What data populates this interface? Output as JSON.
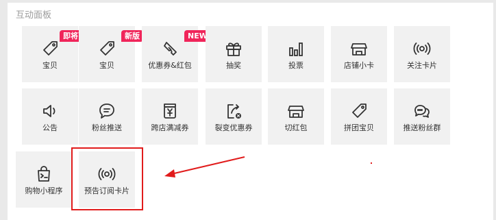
{
  "panel": {
    "title": "互动面板"
  },
  "tiles": [
    {
      "label": "宝贝",
      "icon": "tag-icon",
      "badge": "即将下线"
    },
    {
      "label": "宝贝",
      "icon": "tag-icon",
      "badge": "新版"
    },
    {
      "label": "优惠券&红包",
      "icon": "coupon-icon",
      "badge": "NEW"
    },
    {
      "label": "抽奖",
      "icon": "gift-icon"
    },
    {
      "label": "投票",
      "icon": "bar-chart-icon"
    },
    {
      "label": "店铺小卡",
      "icon": "store-icon"
    },
    {
      "label": "关注卡片",
      "icon": "broadcast-icon"
    },
    {
      "label": "公告",
      "icon": "speaker-icon"
    },
    {
      "label": "粉丝推送",
      "icon": "chat-bubble-icon"
    },
    {
      "label": "跨店满减券",
      "icon": "yuan-jar-icon"
    },
    {
      "label": "裂变优惠券",
      "icon": "share-coupon-icon"
    },
    {
      "label": "切红包",
      "icon": "store-icon"
    },
    {
      "label": "拼团宝贝",
      "icon": "tag-icon"
    },
    {
      "label": "推送粉丝群",
      "icon": "group-chat-icon"
    },
    {
      "label": "购物小程序",
      "icon": "mini-program-bag-icon"
    },
    {
      "label": "预告订阅卡片",
      "icon": "broadcast-icon"
    }
  ],
  "colors": {
    "badge": "#f0255a",
    "highlight": "#e11b1b",
    "tile_bg": "#f1f1f1",
    "icon_stroke": "#333333"
  }
}
